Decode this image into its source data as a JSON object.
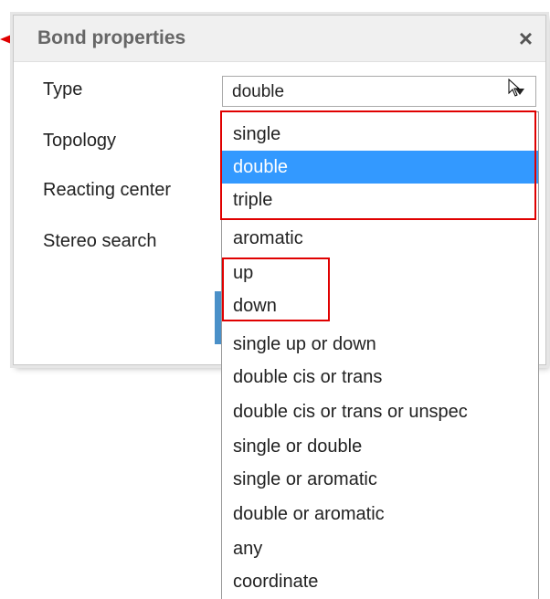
{
  "dialog": {
    "title": "Bond properties",
    "close_symbol": "×",
    "fields": {
      "type_label": "Type",
      "topology_label": "Topology",
      "reacting_center_label": "Reacting center",
      "stereo_search_label": "Stereo search"
    },
    "type_select": {
      "value": "double"
    }
  },
  "dropdown": {
    "options": [
      {
        "label": "single"
      },
      {
        "label": "double",
        "selected": true
      },
      {
        "label": "triple"
      },
      {
        "label": "aromatic"
      },
      {
        "label": "up"
      },
      {
        "label": "down"
      },
      {
        "label": "single up or down"
      },
      {
        "label": "double cis or trans"
      },
      {
        "label": "double cis or trans or unspec"
      },
      {
        "label": "single or double"
      },
      {
        "label": "single or aromatic"
      },
      {
        "label": "double or aromatic"
      },
      {
        "label": "any"
      },
      {
        "label": "coordinate"
      }
    ]
  },
  "colors": {
    "annotation": "#e00000",
    "selection": "#3399ff",
    "ok_button": "#4a90c8"
  },
  "icons": {
    "close": "close-icon",
    "dropdown": "chevron-down-icon",
    "cursor": "mouse-cursor-icon",
    "annotation": "red-arrow-icon"
  }
}
